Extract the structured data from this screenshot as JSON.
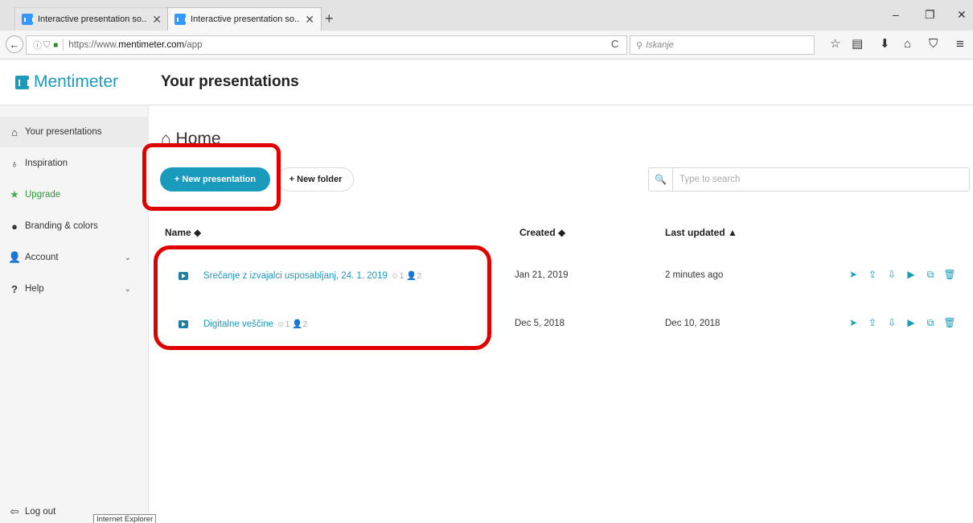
{
  "browser": {
    "tabs": [
      {
        "title": "Interactive presentation so...",
        "close": "✕"
      },
      {
        "title": "Interactive presentation so...",
        "close": "✕"
      }
    ],
    "new_tab": "+",
    "window": {
      "minimize": "–",
      "restore": "❐",
      "close": "✕"
    },
    "back": "←",
    "url_prefix": "https://www.",
    "url_domain": "mentimeter.com",
    "url_path": "/app",
    "reload": "C",
    "search_placeholder": "Iskanje",
    "toolbar_icons": {
      "bookmark": "☆",
      "reader": "▤",
      "download": "⬇",
      "home": "⌂",
      "pocket": "⛉",
      "menu": "≡"
    }
  },
  "app": {
    "brand": "Mentimeter",
    "page_title": "Your presentations",
    "accent": "#1a9bbb"
  },
  "sidebar": {
    "items": [
      {
        "label": "Your presentations",
        "icon": "⌂"
      },
      {
        "label": "Inspiration",
        "icon": "♁"
      },
      {
        "label": "Upgrade",
        "icon": "★"
      },
      {
        "label": "Branding & colors",
        "icon": "●"
      },
      {
        "label": "Account",
        "icon": "👤",
        "chevron": "⌄"
      },
      {
        "label": "Help",
        "icon": "?",
        "chevron": "⌄"
      }
    ],
    "logout": {
      "label": "Log out",
      "icon": "⇦"
    },
    "tooltip": "Internet Explorer"
  },
  "main": {
    "heading": "Home",
    "new_presentation": "+ New presentation",
    "new_folder": "+ New folder",
    "search_placeholder": "Type to search",
    "search_icon": "🔍",
    "columns": {
      "name": "Name ◆",
      "created": "Created ◆",
      "updated": "Last updated ▲"
    },
    "rows": [
      {
        "name": "Srečanje z izvajalci usposabljanj, 24. 1. 2019",
        "meta": "☺1  👤2",
        "created": "Jan 21, 2019",
        "updated": "2 minutes ago"
      },
      {
        "name": "Digitalne veščine",
        "meta": "☺1  👤2",
        "created": "Dec 5, 2018",
        "updated": "Dec 10, 2018"
      }
    ],
    "action_icons": [
      "➤",
      "⇪",
      "⇩",
      "▶",
      "⧉",
      "🗑"
    ]
  },
  "highlight_color": "#e10000"
}
